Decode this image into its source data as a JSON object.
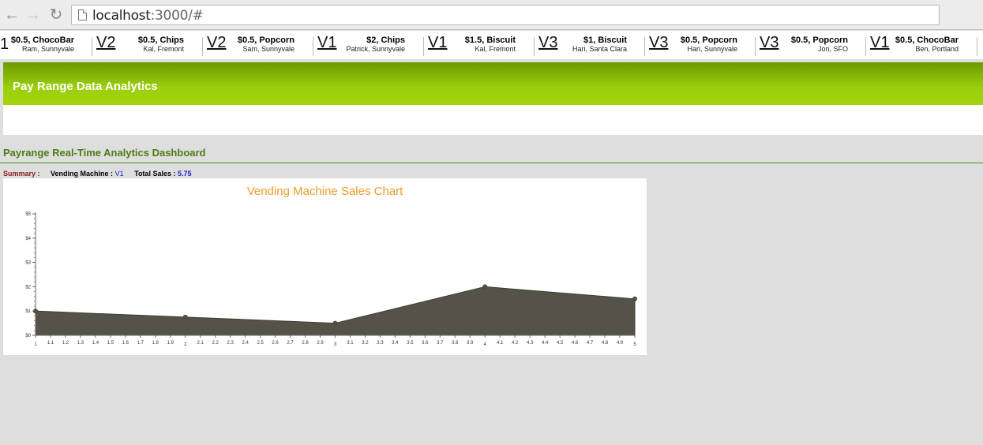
{
  "browser": {
    "url_host": "localhost",
    "url_path": ":3000/#"
  },
  "ticker": {
    "lead": "1",
    "items": [
      {
        "title": "$0.5, ChocoBar",
        "sub": "Ram, Sunnyvale",
        "machine": "V2"
      },
      {
        "title": "$0.5, Chips",
        "sub": "Kal, Fremont",
        "machine": "V2"
      },
      {
        "title": "$0.5, Popcorn",
        "sub": "Sam, Sunnyvale",
        "machine": "V1"
      },
      {
        "title": "$2, Chips",
        "sub": "Patrick, Sunnyvale",
        "machine": "V1"
      },
      {
        "title": "$1.5, Biscuit",
        "sub": "Kal, Fremont",
        "machine": "V3"
      },
      {
        "title": "$1, Biscuit",
        "sub": "Hari, Santa Clara",
        "machine": "V3"
      },
      {
        "title": "$0.5, Popcorn",
        "sub": "Hari, Sunnyvale",
        "machine": "V3"
      },
      {
        "title": "$0.5, Popcorn",
        "sub": "Jon, SFO",
        "machine": "V1"
      },
      {
        "title": "$0.5, ChocoBar",
        "sub": "Ben, Portland",
        "machine": ""
      }
    ]
  },
  "header": {
    "title": "Pay Range Data Analytics"
  },
  "dashboard": {
    "title": "Payrange Real-Time Analytics Dashboard",
    "summary": {
      "label": "Summary :",
      "machine_label": "Vending Machine :",
      "machine_value": "V1",
      "sales_label": "Total Sales :",
      "sales_value": "5.75"
    }
  },
  "colors": {
    "accent_green": "#9ccf0b",
    "title_orange": "#ef9b2a",
    "area_fill": "#555349"
  },
  "chart_data": {
    "type": "area",
    "title": "Vending Machine Sales Chart",
    "x": [
      1,
      2,
      3,
      4,
      5
    ],
    "values": [
      1,
      0.75,
      0.5,
      2,
      1.5
    ],
    "ylim": [
      0,
      5
    ],
    "xlim": [
      1,
      5
    ],
    "yticks": [
      "$0",
      "$1",
      "$2",
      "$3",
      "$4",
      "$5"
    ],
    "xticks": [
      "1",
      "1.1",
      "1.2",
      "1.3",
      "1.4",
      "1.5",
      "1.6",
      "1.7",
      "1.8",
      "1.9",
      "2",
      "2.1",
      "2.2",
      "2.3",
      "2.4",
      "2.5",
      "2.6",
      "2.7",
      "2.8",
      "2.9",
      "3",
      "3.1",
      "3.2",
      "3.3",
      "3.4",
      "3.5",
      "3.6",
      "3.7",
      "3.8",
      "3.9",
      "4",
      "4.1",
      "4.2",
      "4.3",
      "4.4",
      "4.5",
      "4.6",
      "4.7",
      "4.8",
      "4.9",
      "5"
    ],
    "grid": false
  }
}
